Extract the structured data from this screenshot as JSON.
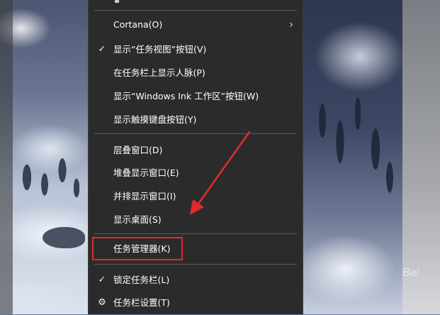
{
  "menu": {
    "items": [
      {
        "label": "Cortana(O)",
        "checked": false,
        "has_submenu": true,
        "icon": ""
      },
      {
        "label": "显示“任务视图”按钮(V)",
        "checked": true,
        "has_submenu": false,
        "icon": "check-icon"
      },
      {
        "label": "在任务栏上显示人脉(P)",
        "checked": false,
        "has_submenu": false,
        "icon": ""
      },
      {
        "label": "显示“Windows Ink 工作区”按钮(W)",
        "checked": false,
        "has_submenu": false,
        "icon": ""
      },
      {
        "label": "显示触摸键盘按钮(Y)",
        "checked": false,
        "has_submenu": false,
        "icon": ""
      },
      {
        "label": "层叠窗口(D)",
        "checked": false,
        "has_submenu": false,
        "icon": ""
      },
      {
        "label": "堆叠显示窗口(E)",
        "checked": false,
        "has_submenu": false,
        "icon": ""
      },
      {
        "label": "并排显示窗口(I)",
        "checked": false,
        "has_submenu": false,
        "icon": ""
      },
      {
        "label": "显示桌面(S)",
        "checked": false,
        "has_submenu": false,
        "icon": ""
      },
      {
        "label": "任务管理器(K)",
        "checked": false,
        "has_submenu": false,
        "icon": "",
        "highlighted": true
      },
      {
        "label": "锁定任务栏(L)",
        "checked": true,
        "has_submenu": false,
        "icon": "check-icon"
      },
      {
        "label": "任务栏设置(T)",
        "checked": false,
        "has_submenu": false,
        "icon": "gear-icon"
      }
    ],
    "check_glyph": "✓",
    "chevron_glyph": "›",
    "gear_glyph": "⚙"
  },
  "annotation": {
    "arrow_color": "#e02b2b",
    "highlight_color": "#e02b2b"
  },
  "wallpaper": {
    "watermark_text": "Bai"
  }
}
